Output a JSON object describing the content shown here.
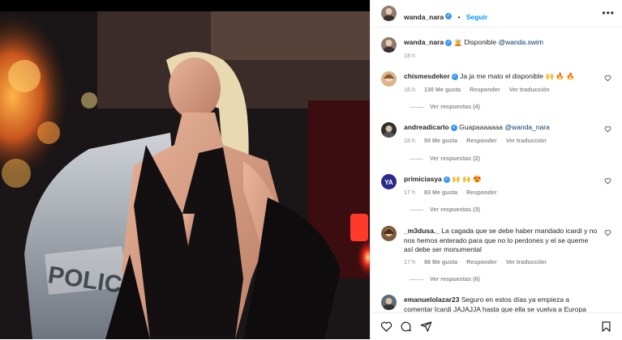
{
  "header": {
    "username": "wanda_nara",
    "separator": "•",
    "follow_label": "Seguir",
    "more_label": "•••"
  },
  "caption": {
    "username": "wanda_nara",
    "text": "🧝 Disponible",
    "mention": "@wanda.swim",
    "time": "18 h"
  },
  "comments": [
    {
      "username": "chismesdeker",
      "text": "Ja ja me mato el disponible 🙌 🔥 🔥",
      "time": "16 h",
      "likes": "130 Me gusta",
      "reply": "Responder",
      "translate": "Ver traducción",
      "replies": "Ver respuestas (4)"
    },
    {
      "username": "andreadicarlo",
      "text": "Guapaaaaaaa",
      "mention": "@wanda_nara",
      "time": "18 h",
      "likes": "50 Me gusta",
      "reply": "Responder",
      "translate": "Ver traducción",
      "replies": "Ver respuestas (2)"
    },
    {
      "username": "primiciasya",
      "text": "🙌 🙌 😍",
      "time": "17 h",
      "likes": "83 Me gusta",
      "reply": "Responder",
      "translate": "",
      "replies": "Ver respuestas (3)"
    },
    {
      "username": "_m3dusa._",
      "text": "La cagada que se debe haber mandado icardi y no nos hemos enterado para que no lo perdones y el se queme así debe ser monumental",
      "time": "17 h",
      "likes": "96 Me gusta",
      "reply": "Responder",
      "translate": "Ver traducción",
      "replies": "Ver respuestas (6)"
    },
    {
      "username": "emanuelolazar23",
      "text": "Seguro en estos días ya empieza a comentar Icardi JAJAJJA hasta que ella se vuelva a Europa"
    }
  ],
  "photo": {
    "car_text": "POLICE"
  },
  "colors": {
    "link_blue": "#0095f6",
    "verified_blue": "#3897f0",
    "muted": "#8e8e8e"
  },
  "icons": [
    "heart-icon",
    "comment-icon",
    "share-icon",
    "bookmark-icon",
    "verified-icon",
    "more-icon"
  ]
}
